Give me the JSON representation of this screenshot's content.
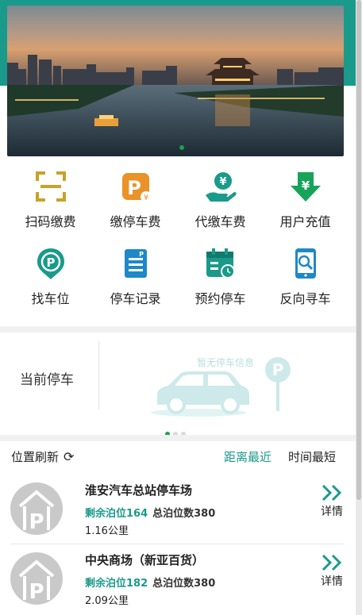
{
  "banner": {
    "image_alt": "city river night scene"
  },
  "grid": {
    "row1": [
      {
        "label": "扫码缴费",
        "icon": "scan-icon"
      },
      {
        "label": "缴停车费",
        "icon": "parking-fee-icon"
      },
      {
        "label": "代缴车费",
        "icon": "proxy-pay-icon"
      },
      {
        "label": "用户充值",
        "icon": "recharge-icon"
      }
    ],
    "row2": [
      {
        "label": "找车位",
        "icon": "find-spot-icon"
      },
      {
        "label": "停车记录",
        "icon": "parking-record-icon"
      },
      {
        "label": "预约停车",
        "icon": "reserve-parking-icon"
      },
      {
        "label": "反向寻车",
        "icon": "reverse-find-car-icon"
      }
    ]
  },
  "current_parking": {
    "label": "当前停车",
    "empty_text": "暂无停车信息",
    "parking_sign": "P"
  },
  "list_header": {
    "refresh": "位置刷新",
    "sort_nearest": "距离最近",
    "sort_shortest_time": "时间最短"
  },
  "parking_lots": [
    {
      "name": "淮安汽车总站停车场",
      "remaining": "剩余泊位164",
      "total": "总泊位数380",
      "distance": "1.16公里",
      "detail": "详情"
    },
    {
      "name": "中央商场（新亚百货）",
      "remaining": "剩余泊位182",
      "total": "总泊位数380",
      "distance": "2.09公里",
      "detail": "详情"
    }
  ],
  "colors": {
    "accent": "#1a9a8a",
    "gold": "#c9a227",
    "orange": "#e9932a",
    "green": "#18a35a",
    "blue": "#1e88c8"
  }
}
